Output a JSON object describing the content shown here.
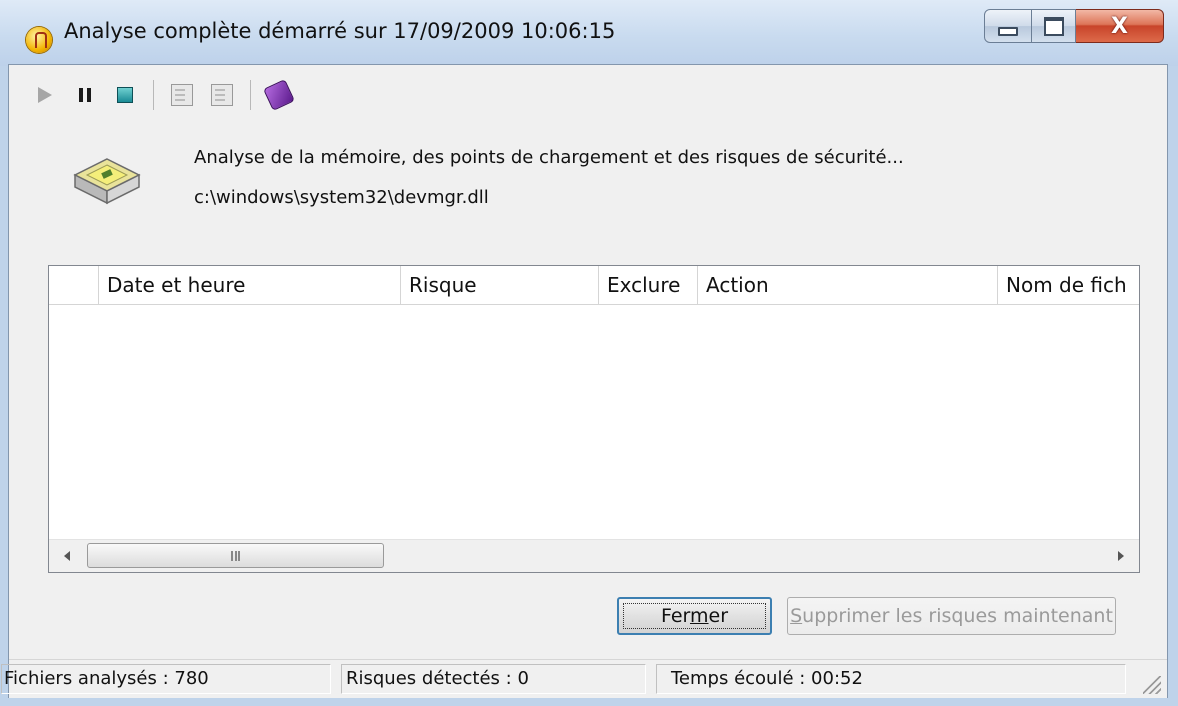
{
  "window": {
    "title": "Analyse complète démarré sur 17/09/2009 10:06:15",
    "close_glyph": "X"
  },
  "toolbar": {
    "icons": [
      "play-icon",
      "pause-icon",
      "stop-icon",
      "properties-icon",
      "details-icon",
      "help-book-icon"
    ]
  },
  "status": {
    "line1": "Analyse de la mémoire, des points de chargement et des risques de sécurité...",
    "line2": "c:\\windows\\system32\\devmgr.dll"
  },
  "list": {
    "columns": [
      "",
      "Date et heure",
      "Risque",
      "Exclure",
      "Action",
      "Nom de fich"
    ],
    "rows": [],
    "scroll_grip": "III"
  },
  "buttons": {
    "close_pre": "Fer",
    "close_ul": "m",
    "close_post": "er",
    "remove_ul": "S",
    "remove_rest": "upprimer les risques maintenant"
  },
  "statusbar": {
    "files": "Fichiers analysés : 780",
    "risks": "Risques détectés : 0",
    "elapsed": "Temps écoulé : 00:52"
  },
  "colors": {
    "title_bar": "#c9dbef",
    "client_bg": "#f0f0f0",
    "close_button": "#c8442a",
    "primary_border": "#3c7fb1"
  }
}
